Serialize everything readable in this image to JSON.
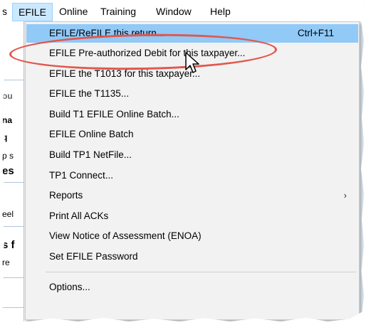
{
  "menubar": {
    "partial_left": "s",
    "efile": "EFILE",
    "online": "Online",
    "training": "Training",
    "window": "Window",
    "help": "Help"
  },
  "background_fragments": [
    "ou",
    "na",
    "q",
    "p s",
    "es",
    "eel",
    "s f",
    "re"
  ],
  "menu": {
    "items": [
      {
        "label": "EFILE/ReFILE this return...",
        "shortcut": "Ctrl+F11",
        "highlighted": true
      },
      {
        "label": "EFILE Pre-authorized Debit for this taxpayer..."
      },
      {
        "label": "EFILE the T1013 for this taxpayer..."
      },
      {
        "label": "EFILE the T1135..."
      },
      {
        "label": "Build T1 EFILE Online Batch..."
      },
      {
        "label": "EFILE Online Batch"
      },
      {
        "label": "Build TP1 NetFile..."
      },
      {
        "label": "TP1 Connect..."
      },
      {
        "label": "Reports",
        "submenu_arrow": "›"
      },
      {
        "label": "Print All ACKs"
      },
      {
        "label": "View Notice of Assessment (ENOA)"
      },
      {
        "label": "Set EFILE Password"
      },
      {
        "label": "Options..."
      }
    ]
  },
  "colors": {
    "highlight": "#91c9f7",
    "callout": "#e2574c",
    "menu_bg": "#f2f2f2",
    "menubar_active": "#cce8ff"
  },
  "icons": {
    "pointer": "mouse-pointer-icon"
  }
}
